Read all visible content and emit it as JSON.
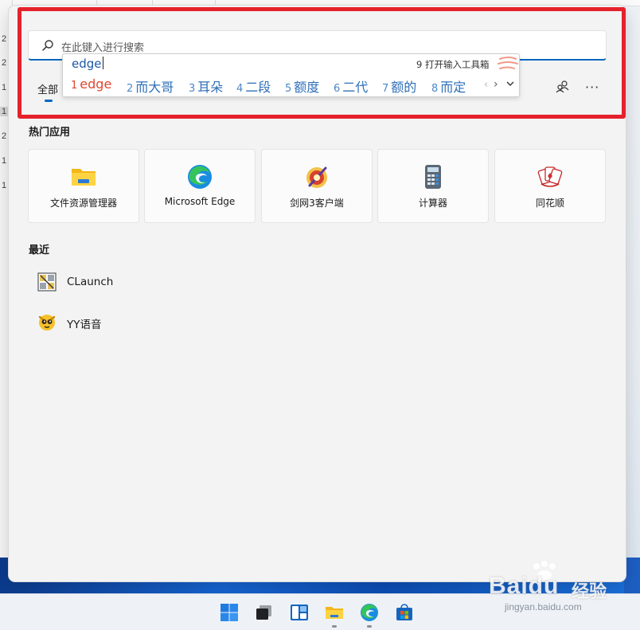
{
  "spreadsheet": {
    "row_numbers": [
      "2",
      "2",
      "1",
      "1",
      "2",
      "1",
      "1"
    ]
  },
  "start_menu": {
    "search": {
      "placeholder": "在此键入进行搜索"
    },
    "tabs": [
      {
        "label": "全部",
        "selected": true
      }
    ],
    "toolbar": {
      "more_label": "···"
    },
    "ime": {
      "input_text": "edge",
      "toolbox_label": "9 打开输入工具箱",
      "candidates": [
        {
          "num": "1",
          "text": "edge"
        },
        {
          "num": "2",
          "text": "而大哥"
        },
        {
          "num": "3",
          "text": "耳朵"
        },
        {
          "num": "4",
          "text": "二段"
        },
        {
          "num": "5",
          "text": "额度"
        },
        {
          "num": "6",
          "text": "二代"
        },
        {
          "num": "7",
          "text": "额的"
        },
        {
          "num": "8",
          "text": "而定"
        }
      ],
      "prev_glyph": "‹",
      "next_glyph": "›"
    },
    "popular_apps": {
      "title": "热门应用",
      "items": [
        {
          "label": "文件资源管理器",
          "icon": "folder-icon"
        },
        {
          "label": "Microsoft Edge",
          "icon": "edge-icon"
        },
        {
          "label": "剑网3客户端",
          "icon": "jx3-icon"
        },
        {
          "label": "计算器",
          "icon": "calculator-icon"
        },
        {
          "label": "同花顺",
          "icon": "tonghuashun-icon"
        }
      ]
    },
    "recent": {
      "title": "最近",
      "items": [
        {
          "label": "CLaunch",
          "icon": "clauch-icon"
        },
        {
          "label": "YY语音",
          "icon": "yy-icon"
        }
      ]
    }
  },
  "taskbar": {
    "icons": [
      "windows-start-icon",
      "task-view-icon",
      "widgets-icon",
      "file-explorer-icon",
      "edge-icon",
      "store-icon"
    ]
  },
  "watermark": {
    "brand": "Baidu",
    "suffix": "经验",
    "url": "jingyan.baidu.com"
  },
  "colors": {
    "accent": "#0067c0",
    "annotation_red": "#e5212c",
    "candidate_first": "#e0452e",
    "candidate": "#2f6fb8"
  }
}
